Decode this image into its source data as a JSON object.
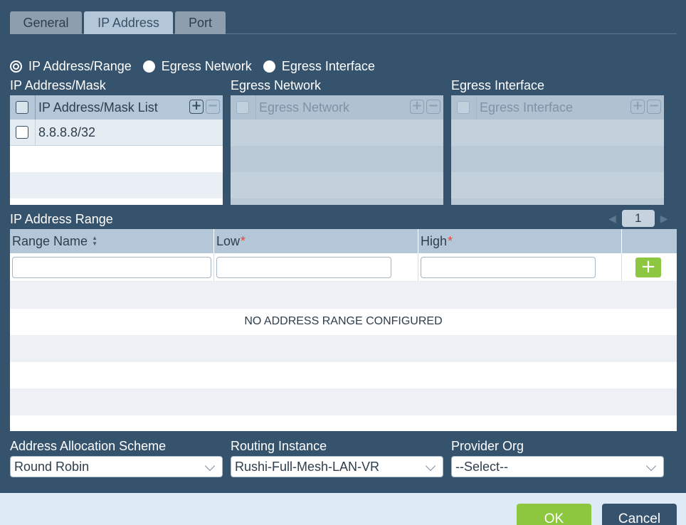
{
  "tabs": [
    {
      "label": "General",
      "active": false
    },
    {
      "label": "IP Address",
      "active": true
    },
    {
      "label": "Port",
      "active": false
    }
  ],
  "type_radio": {
    "options": [
      "IP Address/Range",
      "Egress Network",
      "Egress Interface"
    ],
    "selected": "IP Address/Range"
  },
  "ip_mask": {
    "section_label": "IP Address/Mask",
    "header": "IP Address/Mask List",
    "rows": [
      "8.8.8.8/32"
    ]
  },
  "egress_network": {
    "section_label": "Egress Network",
    "header": "Egress Network"
  },
  "egress_interface": {
    "section_label": "Egress Interface",
    "header": "Egress Interface"
  },
  "ip_range": {
    "section_label": "IP Address Range",
    "page": "1",
    "columns": {
      "name": "Range Name",
      "low": "Low",
      "high": "High"
    },
    "required_marker": "*",
    "empty_message": "NO ADDRESS RANGE CONFIGURED"
  },
  "icons": {
    "add": "+",
    "remove": "−",
    "sort": "sort-icon",
    "chevron": "chevron-down-icon"
  },
  "address_allocation": {
    "label": "Address Allocation Scheme",
    "value": "Round Robin"
  },
  "routing_instance": {
    "label": "Routing Instance",
    "value": "Rushi-Full-Mesh-LAN-VR"
  },
  "provider_org": {
    "label": "Provider Org",
    "value": "--Select--"
  },
  "footer": {
    "ok_label": "OK",
    "cancel_label": "Cancel"
  },
  "colors": {
    "background": "#36536d",
    "accent_green": "#8dc63f",
    "tab_active": "#b4c7d8",
    "required": "#e8463c"
  }
}
